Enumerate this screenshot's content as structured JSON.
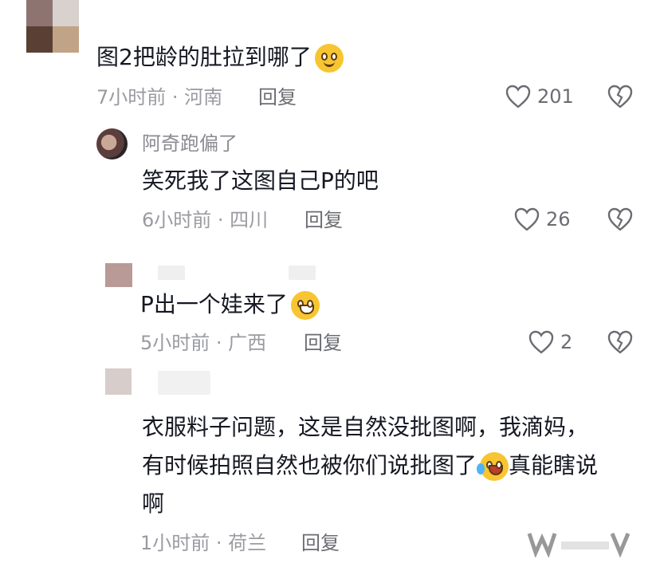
{
  "comments": [
    {
      "text": "图2把龄的肚拉到哪了",
      "time_location": "7小时前 · 河南",
      "reply_label": "回复",
      "likes": "201"
    },
    {
      "username": "阿奇跑偏了",
      "text": "笑死我了这图自己P的吧",
      "time_location": "6小时前 · 四川",
      "reply_label": "回复",
      "likes": "26"
    },
    {
      "text": "P出一个娃来了",
      "time_location": "5小时前 · 广西",
      "reply_label": "回复",
      "likes": "2"
    },
    {
      "text_line1": "衣服料子问题，这是自然没批图啊，我滴妈，",
      "text_line2a": "有时候拍照自然也被你们说批图了",
      "text_line2b": "真能瞎说",
      "text_line3": "啊",
      "time_location": "1小时前 · 荷兰",
      "reply_label": "回复"
    }
  ],
  "icons": {
    "like": "heart-outline-icon",
    "dislike": "broken-heart-icon",
    "emoji_1": "grinning-emoji",
    "emoji_2": "laughing-emoji",
    "emoji_3": "crying-laughing-emoji"
  }
}
